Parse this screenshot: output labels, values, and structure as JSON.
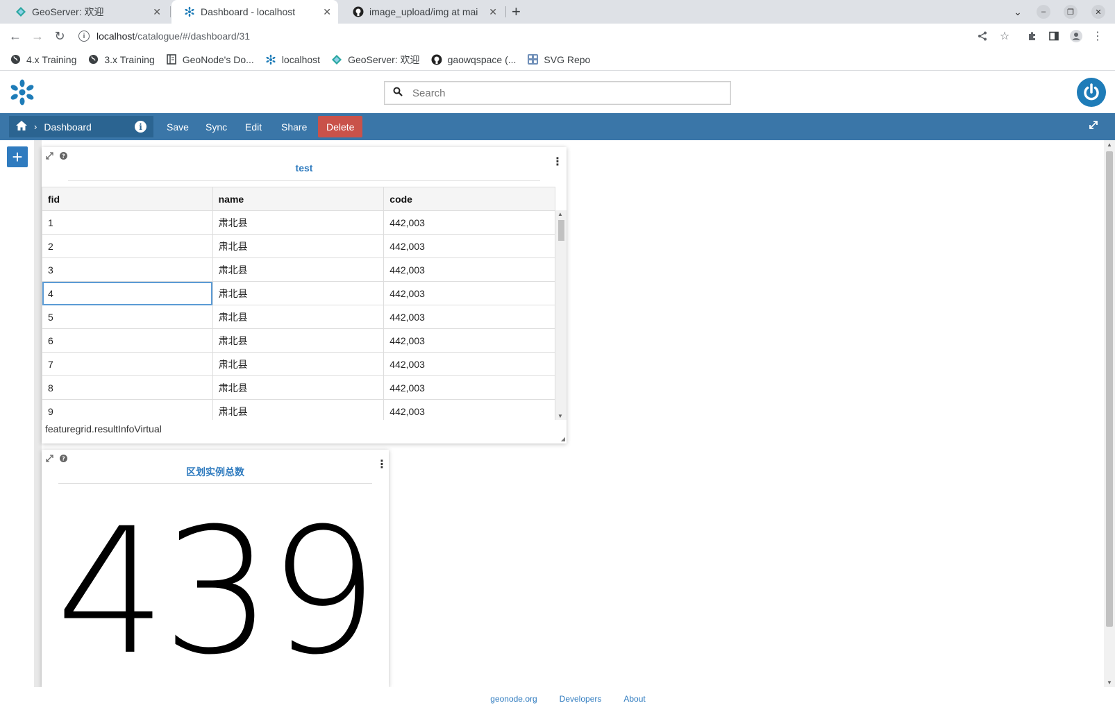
{
  "browser": {
    "tabs": [
      {
        "title": "GeoServer: 欢迎",
        "icon": "geoserver-icon"
      },
      {
        "title": "Dashboard - localhost",
        "icon": "geonode-icon"
      },
      {
        "title": "image_upload/img at mai",
        "icon": "github-icon"
      }
    ],
    "url_host": "localhost",
    "url_path": "/catalogue/#/dashboard/31",
    "bookmarks": [
      {
        "label": "4.x Training",
        "icon": "globe-icon"
      },
      {
        "label": "3.x Training",
        "icon": "globe-icon"
      },
      {
        "label": "GeoNode's Do...",
        "icon": "document-icon"
      },
      {
        "label": "localhost",
        "icon": "geonode-icon"
      },
      {
        "label": "GeoServer: 欢迎",
        "icon": "geoserver-icon"
      },
      {
        "label": "gaowqspace (...",
        "icon": "github-icon"
      },
      {
        "label": "SVG Repo",
        "icon": "svgrepo-icon"
      }
    ]
  },
  "app": {
    "search_placeholder": "Search",
    "breadcrumb": "Dashboard",
    "actions": [
      "Save",
      "Sync",
      "Edit",
      "Share",
      "Delete"
    ],
    "colors": {
      "bar": "#3a76a8",
      "accent": "#2f7bbf",
      "danger": "#c9524a"
    }
  },
  "table_widget": {
    "title": "test",
    "columns": [
      "fid",
      "name",
      "code"
    ],
    "rows": [
      [
        "1",
        "肃北县",
        "442,003"
      ],
      [
        "2",
        "肃北县",
        "442,003"
      ],
      [
        "3",
        "肃北县",
        "442,003"
      ],
      [
        "4",
        "肃北县",
        "442,003"
      ],
      [
        "5",
        "肃北县",
        "442,003"
      ],
      [
        "6",
        "肃北县",
        "442,003"
      ],
      [
        "7",
        "肃北县",
        "442,003"
      ],
      [
        "8",
        "肃北县",
        "442,003"
      ],
      [
        "9",
        "肃北县",
        "442,003"
      ]
    ],
    "selected_row": 3,
    "footer": "featuregrid.resultInfoVirtual"
  },
  "counter_widget": {
    "title": "区划实例总数",
    "value": "439"
  },
  "footer_links": [
    "geonode.org",
    "Developers",
    "About"
  ]
}
